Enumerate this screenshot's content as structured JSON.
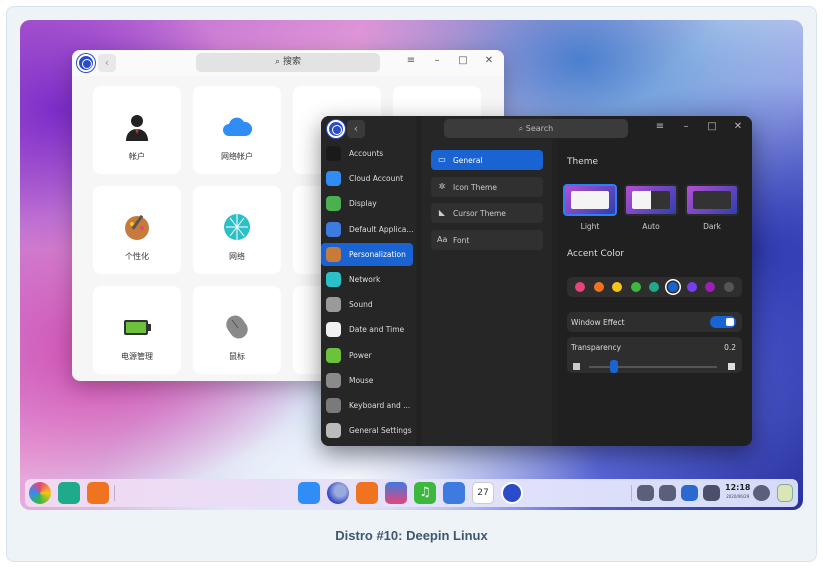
{
  "caption": "Distro #10: Deepin Linux",
  "light_window": {
    "search_placeholder": "搜索",
    "tiles": [
      {
        "label": "帐户",
        "icon": "user-icon"
      },
      {
        "label": "网络帐户",
        "icon": "cloud-icon"
      },
      {
        "label": "个性化",
        "icon": "palette-icon"
      },
      {
        "label": "网络",
        "icon": "network-globe-icon"
      },
      {
        "label": "电源管理",
        "icon": "battery-icon"
      },
      {
        "label": "鼠标",
        "icon": "mouse-icon"
      }
    ]
  },
  "dark_window": {
    "search_placeholder": "Search",
    "sidebar": [
      {
        "label": "Accounts",
        "color": "#1a1a1a"
      },
      {
        "label": "Cloud Account",
        "color": "#2f8df5"
      },
      {
        "label": "Display",
        "color": "#4caf50"
      },
      {
        "label": "Default Applica...",
        "color": "#3d7be0"
      },
      {
        "label": "Personalization",
        "color": "#c77b3a"
      },
      {
        "label": "Network",
        "color": "#2bc0c8"
      },
      {
        "label": "Sound",
        "color": "#9a9a9a"
      },
      {
        "label": "Date and Time",
        "color": "#f0f0f0"
      },
      {
        "label": "Power",
        "color": "#6cc23a"
      },
      {
        "label": "Mouse",
        "color": "#8a8a8a"
      },
      {
        "label": "Keyboard and ...",
        "color": "#7a7a7a"
      },
      {
        "label": "General Settings",
        "color": "#bbbbbb"
      }
    ],
    "active_sidebar": "Personalization",
    "middle": [
      {
        "label": "General",
        "icon": "▭"
      },
      {
        "label": "Icon Theme",
        "icon": "✲"
      },
      {
        "label": "Cursor Theme",
        "icon": "◣"
      },
      {
        "label": "Font",
        "icon": "Aa"
      }
    ],
    "theme_heading": "Theme",
    "themes": [
      "Light",
      "Auto",
      "Dark"
    ],
    "accent_heading": "Accent Color",
    "accent_colors": [
      "#e6457a",
      "#f0731f",
      "#f5c518",
      "#3cb83c",
      "#1faa8b",
      "#1964d2",
      "#7a3cf0",
      "#9b1fb5",
      "#555555"
    ],
    "selected_accent_index": 5,
    "window_effect_label": "Window Effect",
    "window_effect_on": true,
    "transparency_label": "Transparency",
    "transparency_value": "0.2"
  },
  "dock": {
    "time": "12:18",
    "date": "2020/06/29",
    "calendar_day": "27"
  }
}
